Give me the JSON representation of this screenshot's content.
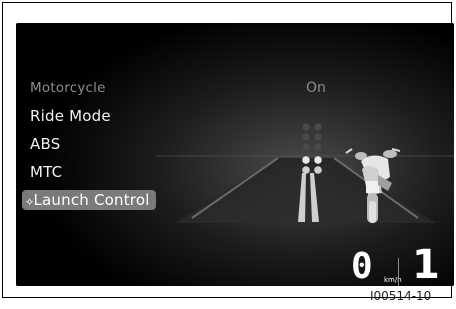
{
  "menu": {
    "items": [
      {
        "label": "Motorcycle",
        "state": "dim"
      },
      {
        "label": "Ride Mode",
        "state": "normal"
      },
      {
        "label": "ABS",
        "state": "normal"
      },
      {
        "label": "MTC",
        "state": "normal"
      },
      {
        "label": "Launch Control",
        "state": "selected",
        "prefix_icon": "arrow-right-icon"
      }
    ]
  },
  "status_value": "On",
  "dashboard": {
    "speed": "0",
    "speed_unit": "km/h",
    "gear": "1"
  },
  "illustration": {
    "traffic_light_dots_total": 6,
    "traffic_light_dots_lit": 2
  },
  "image_code": "I00514-10",
  "colors": {
    "screen_bg": "#000000",
    "text": "#f2f2f2",
    "dim_text": "#8c8c8c",
    "highlight": "#7a7a7a"
  }
}
